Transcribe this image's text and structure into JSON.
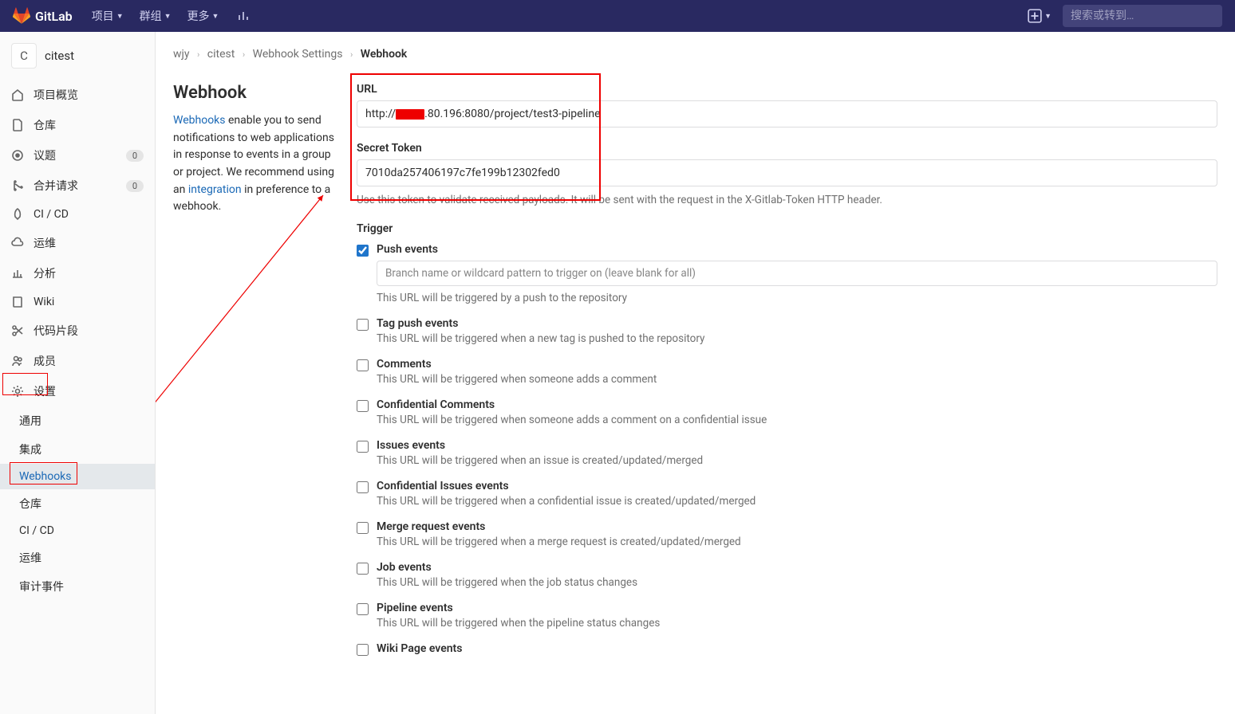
{
  "navbar": {
    "brand": "GitLab",
    "items": [
      "项目",
      "群组",
      "更多"
    ],
    "search_placeholder": "搜索或转到…"
  },
  "sidebar": {
    "project_avatar_letter": "C",
    "project_name": "citest",
    "items": [
      {
        "label": "项目概览",
        "icon": "home",
        "badge": null
      },
      {
        "label": "仓库",
        "icon": "doc",
        "badge": null
      },
      {
        "label": "议题",
        "icon": "issues",
        "badge": "0"
      },
      {
        "label": "合并请求",
        "icon": "merge",
        "badge": "0"
      },
      {
        "label": "CI / CD",
        "icon": "rocket",
        "badge": null
      },
      {
        "label": "运维",
        "icon": "cloud",
        "badge": null
      },
      {
        "label": "分析",
        "icon": "chart",
        "badge": null
      },
      {
        "label": "Wiki",
        "icon": "book",
        "badge": null
      },
      {
        "label": "代码片段",
        "icon": "scissors",
        "badge": null
      },
      {
        "label": "成员",
        "icon": "members",
        "badge": null
      },
      {
        "label": "设置",
        "icon": "gear",
        "badge": null,
        "active": true
      }
    ],
    "sub_items": [
      "通用",
      "集成",
      "Webhooks",
      "仓库",
      "CI / CD",
      "运维",
      "审计事件"
    ],
    "active_sub": "Webhooks"
  },
  "breadcrumb": {
    "wjy": "wjy",
    "citest": "citest",
    "wh_settings": "Webhook Settings",
    "webhook": "Webhook"
  },
  "left": {
    "title": "Webhook",
    "desc_1": "Webhooks",
    "desc_2": " enable you to send notifications to web applications in response to events in a group or project. We recommend using an ",
    "desc_3": "integration",
    "desc_4": " in preference to a webhook."
  },
  "form": {
    "url_label": "URL",
    "url_prefix": "http://",
    "url_suffix": ".80.196:8080/project/test3-pipeline",
    "token_label": "Secret Token",
    "token_value": "7010da257406197c7fe199b12302fed0",
    "token_help": "Use this token to validate received payloads. It will be sent with the request in the X-Gitlab-Token HTTP header.",
    "trigger_label": "Trigger",
    "branch_placeholder": "Branch name or wildcard pattern to trigger on (leave blank for all)",
    "triggers": [
      {
        "name": "Push events",
        "desc": "This URL will be triggered by a push to the repository",
        "checked": true,
        "has_branch": true
      },
      {
        "name": "Tag push events",
        "desc": "This URL will be triggered when a new tag is pushed to the repository",
        "checked": false
      },
      {
        "name": "Comments",
        "desc": "This URL will be triggered when someone adds a comment",
        "checked": false
      },
      {
        "name": "Confidential Comments",
        "desc": "This URL will be triggered when someone adds a comment on a confidential issue",
        "checked": false
      },
      {
        "name": "Issues events",
        "desc": "This URL will be triggered when an issue is created/updated/merged",
        "checked": false
      },
      {
        "name": "Confidential Issues events",
        "desc": "This URL will be triggered when a confidential issue is created/updated/merged",
        "checked": false
      },
      {
        "name": "Merge request events",
        "desc": "This URL will be triggered when a merge request is created/updated/merged",
        "checked": false
      },
      {
        "name": "Job events",
        "desc": "This URL will be triggered when the job status changes",
        "checked": false
      },
      {
        "name": "Pipeline events",
        "desc": "This URL will be triggered when the pipeline status changes",
        "checked": false
      },
      {
        "name": "Wiki Page events",
        "desc": "",
        "checked": false
      }
    ]
  }
}
